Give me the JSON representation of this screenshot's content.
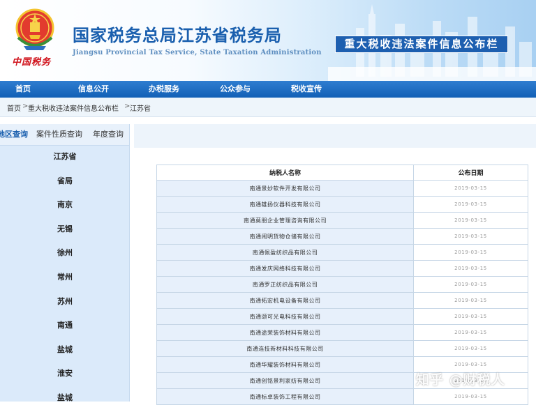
{
  "header": {
    "title": "国家税务总局江苏省税务局",
    "subtitle": "Jiangsu Provincial Tax Service, State Taxation Administration",
    "emblem_script": "中国税务",
    "banner": "重大税收违法案件信息公布栏"
  },
  "nav": {
    "items": [
      "首页",
      "信息公开",
      "办税服务",
      "公众参与",
      "税收宣传"
    ]
  },
  "breadcrumb": {
    "items": [
      "首页",
      "重大税收违法案件信息公布栏",
      "江苏省"
    ],
    "separator": ">"
  },
  "sidebar": {
    "tabs": [
      "地区查询",
      "案件性质查询",
      "年度查询"
    ],
    "active_tab": "地区查询",
    "regions": [
      "江苏省",
      "省局",
      "南京",
      "无锡",
      "徐州",
      "常州",
      "苏州",
      "南通",
      "盐城",
      "淮安",
      "盐城"
    ]
  },
  "table": {
    "headers": [
      "纳税人名称",
      "公布日期"
    ],
    "rows": [
      {
        "name": "南通景妙软件开发有限公司",
        "date": "2019-03-15"
      },
      {
        "name": "南通雄扬仪器科技有限公司",
        "date": "2019-03-15"
      },
      {
        "name": "南通莫朋企业管理咨询有限公司",
        "date": "2019-03-15"
      },
      {
        "name": "南通闹明货物仓储有限公司",
        "date": "2019-03-15"
      },
      {
        "name": "南通佩盈纺织品有限公司",
        "date": "2019-03-15"
      },
      {
        "name": "南通发庆网络科技有限公司",
        "date": "2019-03-15"
      },
      {
        "name": "南通罗正纺织品有限公司",
        "date": "2019-03-15"
      },
      {
        "name": "南通拓宏机电设备有限公司",
        "date": "2019-03-15"
      },
      {
        "name": "南通颂可光电科技有限公司",
        "date": "2019-03-15"
      },
      {
        "name": "南通途荣装饰材料有限公司",
        "date": "2019-03-15"
      },
      {
        "name": "南通连技新材料科技有限公司",
        "date": "2019-03-15"
      },
      {
        "name": "南通华耀装饰材料有限公司",
        "date": "2019-03-15"
      },
      {
        "name": "南通创铭景利家纺有限公司",
        "date": "2019-03-15"
      },
      {
        "name": "南通标卓装饰工程有限公司",
        "date": "2019-03-15"
      }
    ]
  },
  "watermark": "知乎 @财税人",
  "colors": {
    "brand_blue": "#1a5fae",
    "nav_blue": "#1260b6",
    "emblem_red": "#d0121b",
    "row_blue": "#e7f0fb"
  }
}
